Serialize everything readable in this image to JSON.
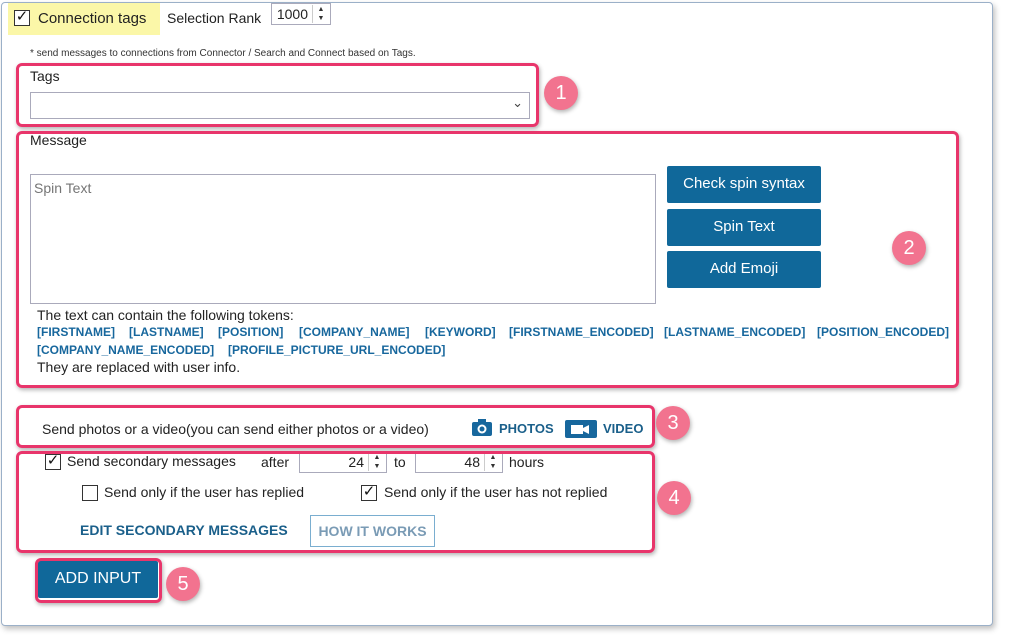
{
  "header": {
    "connection_tags_label": "Connection tags",
    "connection_tags_checked": true,
    "selection_rank_label": "Selection Rank",
    "selection_rank_value": "1000",
    "note": "* send messages to connections from Connector / Search and Connect based on Tags."
  },
  "tags": {
    "label": "Tags",
    "value": ""
  },
  "message": {
    "label": "Message",
    "placeholder": "Spin Text",
    "buttons": {
      "check_spin": "Check spin syntax",
      "spin_text": "Spin Text",
      "add_emoji": "Add Emoji"
    },
    "tokens_intro": "The text can contain the following tokens:",
    "tokens": [
      "[FIRSTNAME]",
      "[LASTNAME]",
      "[POSITION]",
      "[COMPANY_NAME]",
      "[KEYWORD]",
      "[FIRSTNAME_ENCODED]",
      "[LASTNAME_ENCODED]",
      "[POSITION_ENCODED]",
      "[COMPANY_NAME_ENCODED]",
      "[PROFILE_PICTURE_URL_ENCODED]"
    ],
    "tokens_outro": "They are replaced with user info."
  },
  "media": {
    "label": "Send photos or a video(you can send either photos or a video)",
    "photos": "PHOTOS",
    "video": "VIDEO"
  },
  "secondary": {
    "send_label": "Send secondary messages",
    "send_checked": true,
    "after": "after",
    "after_value": "24",
    "to": "to",
    "to_value": "48",
    "hours": "hours",
    "replied_label": "Send only if the user has replied",
    "replied_checked": false,
    "not_replied_label": "Send only if the user has not replied",
    "not_replied_checked": true,
    "edit_link": "EDIT SECONDARY MESSAGES",
    "how_it_works": "HOW IT WORKS"
  },
  "add_input": "ADD INPUT",
  "callouts": [
    "1",
    "2",
    "3",
    "4",
    "5"
  ],
  "colors": {
    "accent": "#10689a",
    "callout": "#e8356b",
    "badge": "#f2738f",
    "highlight": "#fbf7a8",
    "token": "#17679d"
  }
}
